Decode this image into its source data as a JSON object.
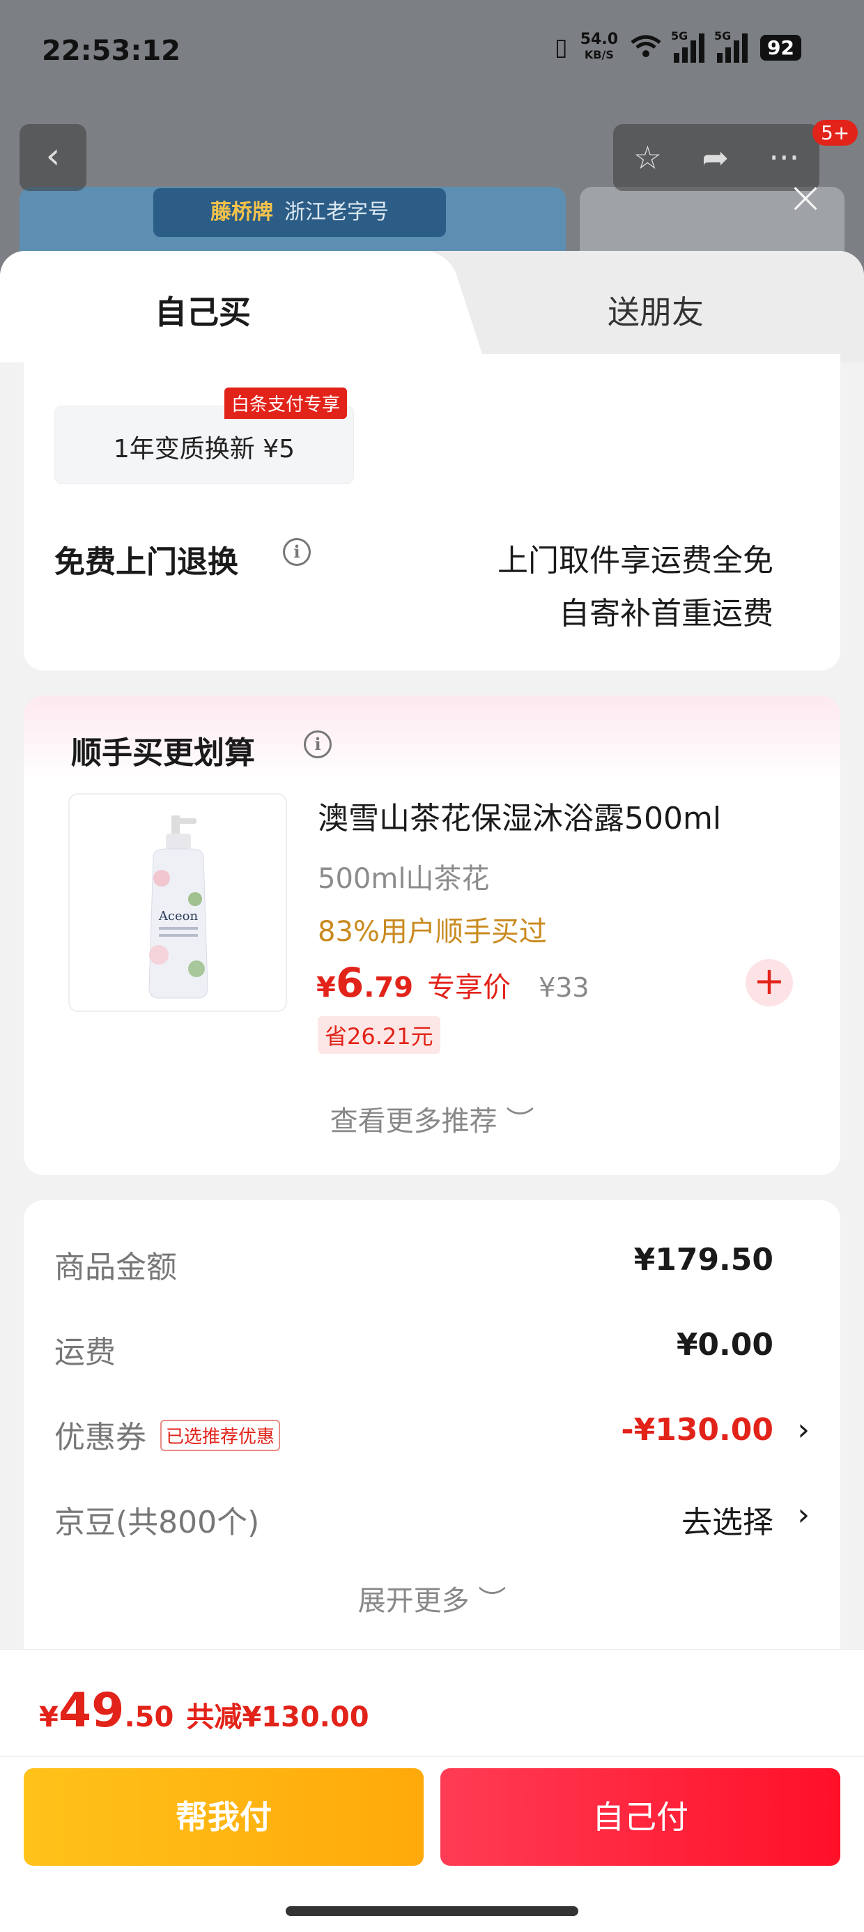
{
  "status_bar": {
    "time": "22:53:12",
    "net_speed": "54.0",
    "net_unit": "KB/S",
    "signal1_label": "5G",
    "signal2_label": "5G",
    "battery": "92"
  },
  "background": {
    "badge_more": "5+",
    "brand_name": "藤桥牌",
    "brand_tagline": "浙江老字号"
  },
  "tabs": {
    "self": "自己买",
    "friend": "送朋友"
  },
  "service": {
    "label": "1年变质换新  ¥5",
    "tag": "白条支付专享",
    "return_title": "免费上门退换",
    "return_line1": "上门取件享运费全免",
    "return_line2": "自寄补首重运费"
  },
  "recommend": {
    "title": "顺手买更划算",
    "product_name": "澳雪山茶花保湿沐浴露500ml",
    "product_spec": "500ml山茶花",
    "product_rate": "83%用户顺手买过",
    "price_currency": "¥",
    "price_int": "6",
    "price_dec": ".79",
    "price_tag": "专享价",
    "price_orig": "¥33",
    "save_text": "省26.21元",
    "more": "查看更多推荐 ︶",
    "add_symbol": "+"
  },
  "summary": {
    "goods_label": "商品金额",
    "goods_value": "¥179.50",
    "shipping_label": "运费",
    "shipping_value": "¥0.00",
    "coupon_label": "优惠券",
    "coupon_tag": "已选推荐优惠",
    "coupon_value": "-¥130.00",
    "beans_label": "京豆(共800个)",
    "beans_value": "去选择",
    "expand": "展开更多 ︶"
  },
  "bottom": {
    "total_currency": "¥",
    "total_int": "49",
    "total_dec": ".50",
    "total_discount": "共减¥130.00",
    "help_pay": "帮我付",
    "self_pay": "自己付"
  },
  "colors": {
    "accent_red": "#e2231a",
    "accent_yellow": "#ffb512",
    "rate_gold": "#c98a1f"
  }
}
